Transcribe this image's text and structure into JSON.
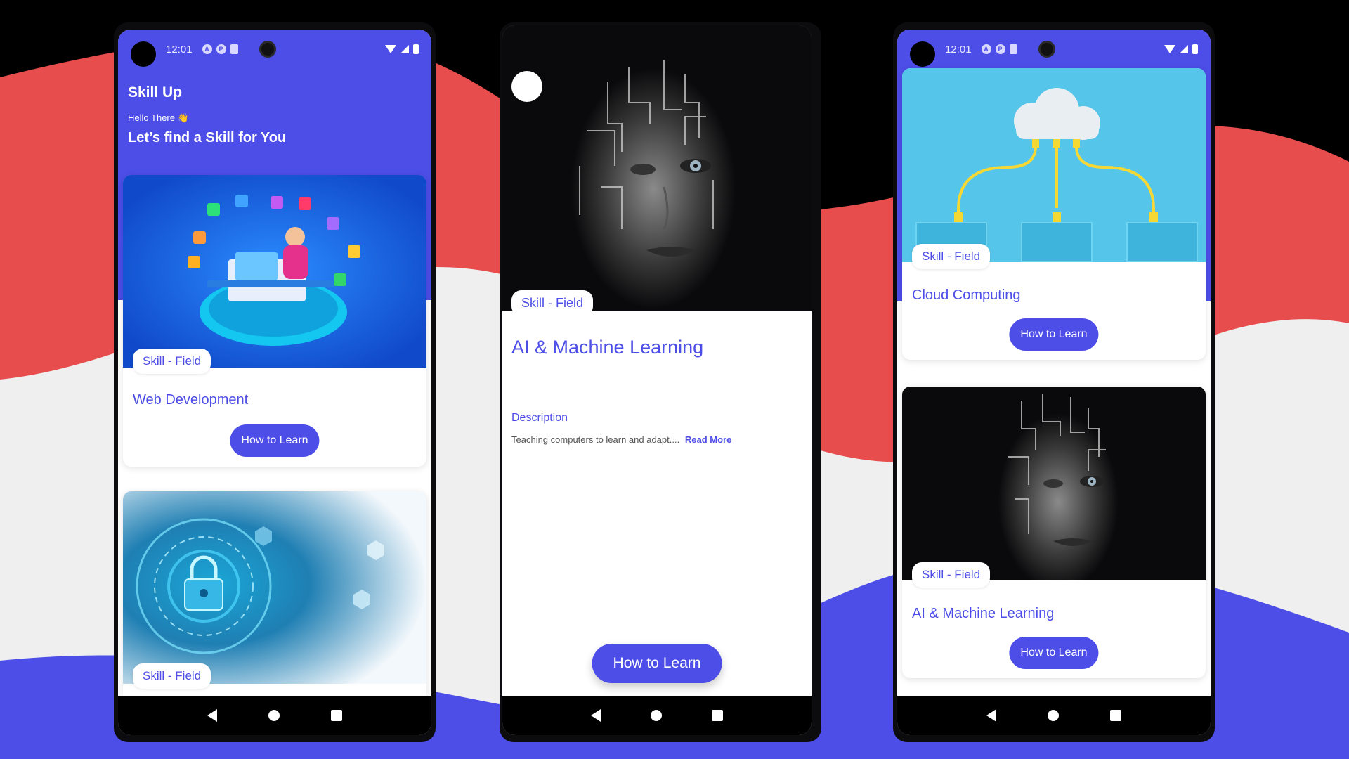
{
  "colors": {
    "accent": "#4d4de8",
    "bg_red": "#e84d4d",
    "bg_light": "#efefef",
    "bg_blue": "#4d4de8"
  },
  "status": {
    "time": "12:01"
  },
  "phone1": {
    "app_title": "Skill Up",
    "greeting": "Hello There 👋",
    "tagline": "Let’s find a Skill for You",
    "cards": [
      {
        "chip": "Skill - Field",
        "title": "Web Development",
        "button": "How to Learn",
        "image": "web-development-illustration"
      },
      {
        "chip": "Skill - Field",
        "image": "cyber-security-lock-illustration"
      }
    ]
  },
  "phone2": {
    "chip": "Skill - Field",
    "title": "AI & Machine Learning",
    "description_label": "Description",
    "description": "Teaching computers to learn and adapt....",
    "read_more": "Read More",
    "button": "How to Learn",
    "image": "ai-face-circuit-illustration"
  },
  "phone3": {
    "cards": [
      {
        "chip": "Skill - Field",
        "title": "Cloud Computing",
        "button": "How to Learn",
        "image": "cloud-network-illustration"
      },
      {
        "chip": "Skill - Field",
        "title": "AI & Machine Learning",
        "button": "How to Learn",
        "image": "ai-face-circuit-illustration"
      }
    ]
  }
}
